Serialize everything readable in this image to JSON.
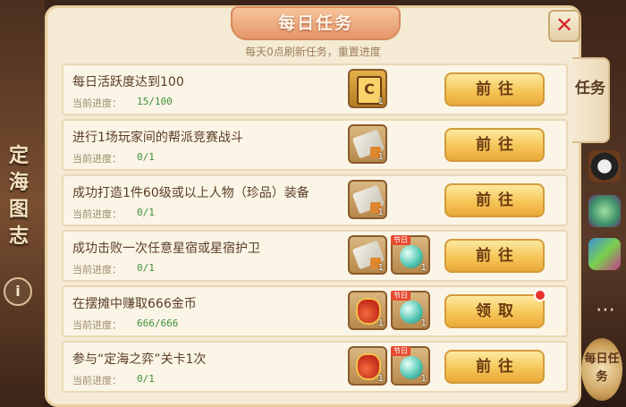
{
  "background": {
    "left_vertical_text": "定海图志",
    "info_icon": "i",
    "right_bottom_badge": "每日任务"
  },
  "panel": {
    "title": "每日任务",
    "subtitle": "每天0点刷新任务，重置进度",
    "close_icon": "✕"
  },
  "side_tab": {
    "label": "任务"
  },
  "progress_label": "当前进度：",
  "tasks": [
    {
      "name": "每日活跃度达到100",
      "progress": "15/100",
      "rewards": [
        "card-icon"
      ],
      "button": "前往",
      "badge": false
    },
    {
      "name": "进行1场玩家间的帮派竞赛战斗",
      "progress": "0/1",
      "rewards": [
        "scroll-icon"
      ],
      "button": "前往",
      "badge": false
    },
    {
      "name": "成功打造1件60级或以上人物（珍品）装备",
      "progress": "0/1",
      "rewards": [
        "scroll-icon"
      ],
      "button": "前往",
      "badge": false
    },
    {
      "name": "成功击败一次任意星宿或星宿护卫",
      "progress": "0/1",
      "rewards": [
        "scroll-icon",
        "orb-icon"
      ],
      "button": "前往",
      "badge": false
    },
    {
      "name": "在摆摊中赚取666金币",
      "progress": "666/666",
      "rewards": [
        "bag-icon",
        "orb-icon"
      ],
      "button": "领取",
      "badge": true
    },
    {
      "name": "参与“定海之弈”关卡1次",
      "progress": "0/1",
      "rewards": [
        "bag-icon",
        "orb-icon"
      ],
      "button": "前往",
      "badge": false
    }
  ],
  "reward_qty": "1",
  "orb_tag": "节日",
  "colors": {
    "accent": "#f6c657",
    "progress_green": "#3f8f3a",
    "close_red": "#d6262a",
    "panel_bg": "#f5ead3"
  }
}
